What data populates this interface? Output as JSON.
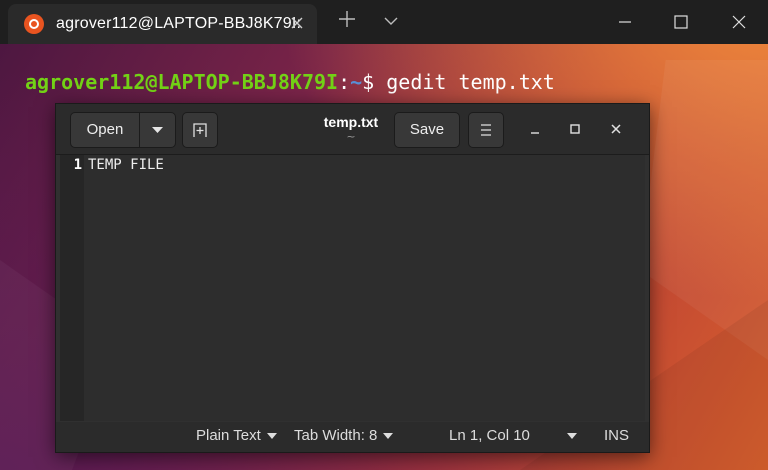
{
  "terminal": {
    "tab_title": "agrover112@LAPTOP-BBJ8K79I:",
    "prompt_user_host": "agrover112@LAPTOP-BBJ8K79I",
    "prompt_colon": ":",
    "prompt_path": "~",
    "prompt_dollar": "$",
    "command": "gedit temp.txt"
  },
  "gedit": {
    "open_label": "Open",
    "save_label": "Save",
    "doc_title": "temp.txt",
    "doc_subtitle": "~",
    "lines": [
      {
        "number": "1",
        "text": "TEMP FILE"
      }
    ],
    "status": {
      "language": "Plain Text",
      "tab_width": "Tab Width: 8",
      "position": "Ln 1, Col 10",
      "mode": "INS"
    }
  },
  "colors": {
    "prompt_user": "#73d216",
    "prompt_path": "#5a8fd6",
    "ubuntu_orange": "#e95420"
  },
  "icons": {
    "tab_logo": "ubuntu-logo-icon",
    "tab_close": "close-icon",
    "new_tab": "plus-icon",
    "tab_dropdown": "chevron-down-icon",
    "gedit_new_tab": "new-tab-icon",
    "gedit_menu": "hamburger-menu-icon"
  }
}
